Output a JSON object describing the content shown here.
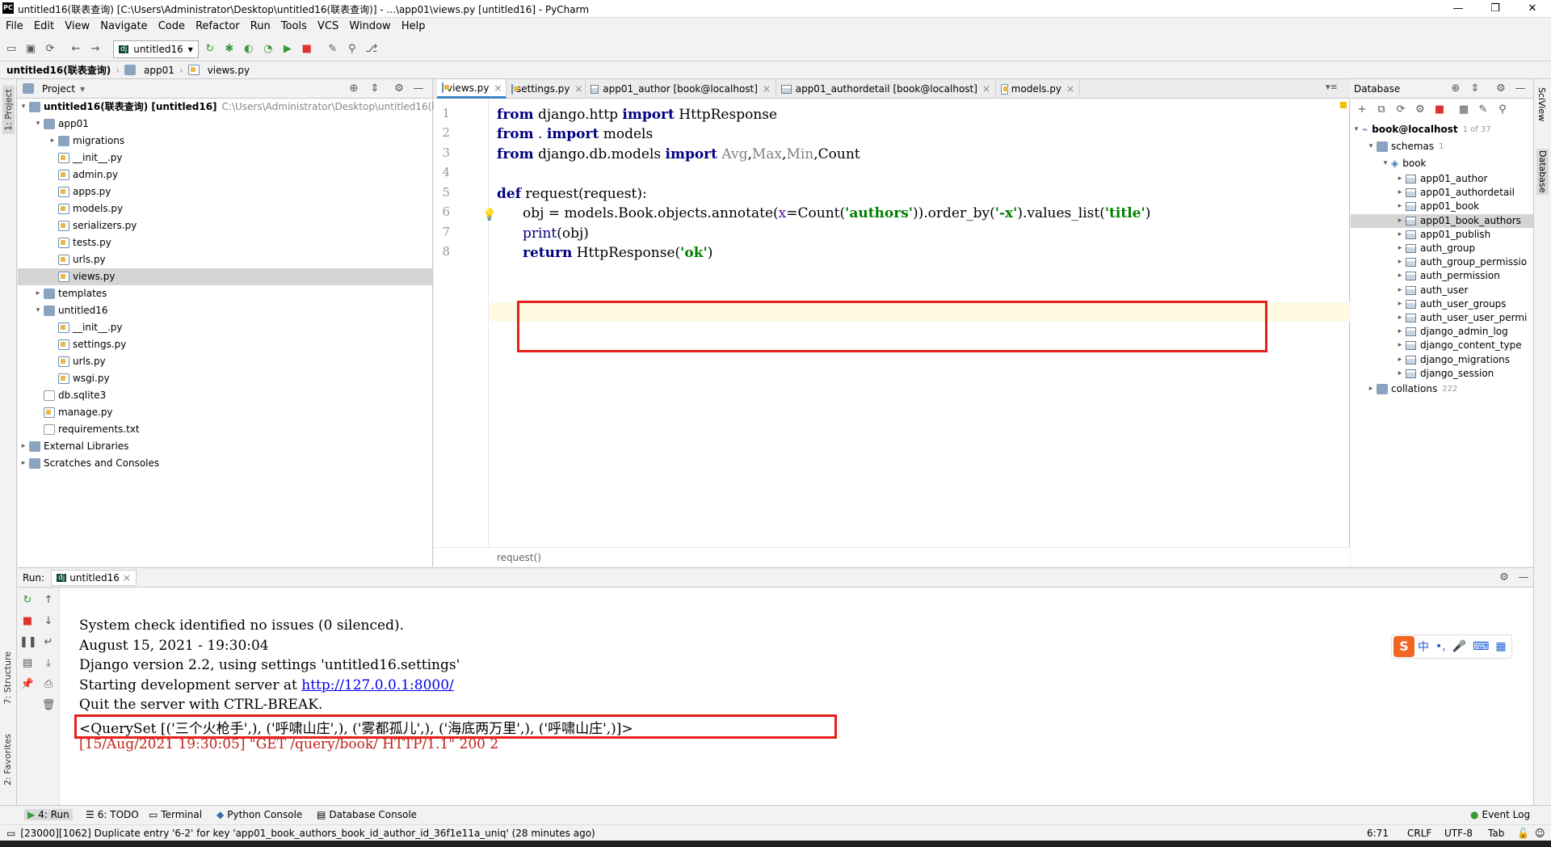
{
  "window": {
    "title": "untitled16(联表查询) [C:\\Users\\Administrator\\Desktop\\untitled16(联表查询)] - ...\\app01\\views.py [untitled16] - PyCharm",
    "logo": "PC"
  },
  "menu": [
    "File",
    "Edit",
    "View",
    "Navigate",
    "Code",
    "Refactor",
    "Run",
    "Tools",
    "VCS",
    "Window",
    "Help"
  ],
  "toolbar": {
    "run_config": "untitled16"
  },
  "breadcrumb": [
    "untitled16(联表查询)",
    "app01",
    "views.py"
  ],
  "project_panel": {
    "title": "Project",
    "root_label": "untitled16(联表查询) [untitled16]",
    "root_path": "C:\\Users\\Administrator\\Desktop\\untitled16(联表",
    "items": [
      {
        "label": "app01",
        "type": "folder",
        "depth": 1,
        "open": true
      },
      {
        "label": "migrations",
        "type": "folder",
        "depth": 2,
        "open": false
      },
      {
        "label": "__init__.py",
        "type": "py",
        "depth": 2
      },
      {
        "label": "admin.py",
        "type": "py",
        "depth": 2
      },
      {
        "label": "apps.py",
        "type": "py",
        "depth": 2
      },
      {
        "label": "models.py",
        "type": "py",
        "depth": 2
      },
      {
        "label": "serializers.py",
        "type": "py",
        "depth": 2
      },
      {
        "label": "tests.py",
        "type": "py",
        "depth": 2
      },
      {
        "label": "urls.py",
        "type": "py",
        "depth": 2
      },
      {
        "label": "views.py",
        "type": "py",
        "depth": 2,
        "selected": true
      },
      {
        "label": "templates",
        "type": "folder",
        "depth": 1
      },
      {
        "label": "untitled16",
        "type": "folder",
        "depth": 1,
        "open": true
      },
      {
        "label": "__init__.py",
        "type": "py",
        "depth": 2
      },
      {
        "label": "settings.py",
        "type": "py",
        "depth": 2
      },
      {
        "label": "urls.py",
        "type": "py",
        "depth": 2
      },
      {
        "label": "wsgi.py",
        "type": "py",
        "depth": 2
      },
      {
        "label": "db.sqlite3",
        "type": "gen",
        "depth": 1
      },
      {
        "label": "manage.py",
        "type": "py",
        "depth": 1
      },
      {
        "label": "requirements.txt",
        "type": "gen",
        "depth": 1
      },
      {
        "label": "External Libraries",
        "type": "lib",
        "depth": 0
      },
      {
        "label": "Scratches and Consoles",
        "type": "lib",
        "depth": 0
      }
    ]
  },
  "editor": {
    "tabs": [
      "views.py",
      "settings.py",
      "app01_author [book@localhost]",
      "app01_authordetail [book@localhost]",
      "models.py"
    ],
    "active_tab": 0,
    "line_numbers": [
      "1",
      "2",
      "3",
      "4",
      "5",
      "6",
      "7",
      "8"
    ],
    "lines": {
      "l1": {
        "a": "from",
        "b": " django.http ",
        "c": "import",
        "d": " HttpResponse"
      },
      "l2": {
        "a": "from",
        "b": " . ",
        "c": "import",
        "d": " models"
      },
      "l3": {
        "a": "from",
        "b": " django.db.models ",
        "c": "import",
        "d": " ",
        "e": "Avg",
        "f": ",",
        "g": "Max",
        "h": ",",
        "i": "Min",
        "j": ",Count"
      },
      "l5": {
        "a": "def",
        "b": " request(request):"
      },
      "l6": {
        "a": "obj = models.Book.objects.annotate(",
        "b": "x",
        "c": "=Count(",
        "d": "'authors'",
        "e": ")).order_by(",
        "f": "'-x'",
        "g": ").values_list(",
        "h": "'title'",
        "i": ")"
      },
      "l7": {
        "a": "print",
        "b": "(obj)"
      },
      "l8": {
        "a": "return",
        "b": " HttpResponse(",
        "c": "'ok'",
        "d": ")"
      }
    },
    "breadcrumb_func": "request()"
  },
  "database_panel": {
    "title": "Database",
    "host": "book@localhost",
    "host_count": "1 of 37",
    "schemas_label": "schemas",
    "schemas_count": "1",
    "db_label": "book",
    "tables": [
      "app01_author",
      "app01_authordetail",
      "app01_book",
      "app01_book_authors",
      "app01_publish",
      "auth_group",
      "auth_group_permissio",
      "auth_permission",
      "auth_user",
      "auth_user_groups",
      "auth_user_user_permi",
      "django_admin_log",
      "django_content_type",
      "django_migrations",
      "django_session"
    ],
    "selected_table": 3,
    "collations_label": "collations",
    "collations_count": "222"
  },
  "run_panel": {
    "label": "Run:",
    "tab": "untitled16",
    "lines": [
      "System check identified no issues (0 silenced).",
      "August 15, 2021 - 19:30:04",
      "Django version 2.2, using settings 'untitled16.settings'"
    ],
    "server_prefix": "Starting development server at ",
    "server_link": "http://127.0.0.1:8000/",
    "quit_line": "Quit the server with CTRL-BREAK.",
    "queryset_line": "<QuerySet [('三个火枪手',), ('呼啸山庄',), ('雾都孤儿',), ('海底两万里',), ('呼啸山庄',)]>",
    "request_line": "[15/Aug/2021 19:30:05] \"GET /query/book/ HTTP/1.1\" 200 2"
  },
  "left_strip": {
    "project": "1: Project",
    "structure": "7: Structure",
    "favorites": "2: Favorites"
  },
  "right_strip": {
    "sciview": "SciView",
    "database": "Database"
  },
  "bottom_tabs": [
    "4: Run",
    "6: TODO",
    "Terminal",
    "Python Console",
    "Database Console"
  ],
  "event_log": "Event Log",
  "status": {
    "message": "[23000][1062] Duplicate entry '6-2' for key 'app01_book_authors_book_id_author_id_36f1e11a_uniq' (28 minutes ago)",
    "position": "6:71",
    "line_sep": "CRLF",
    "encoding": "UTF-8",
    "indent": "Tab"
  },
  "ime": {
    "mode": "中",
    "logo": "S"
  },
  "colors": {
    "accent": "#4083c9",
    "highlight_box": "#e8201c",
    "keyword": "#000080",
    "string": "#008000",
    "error": "#c0251c"
  }
}
